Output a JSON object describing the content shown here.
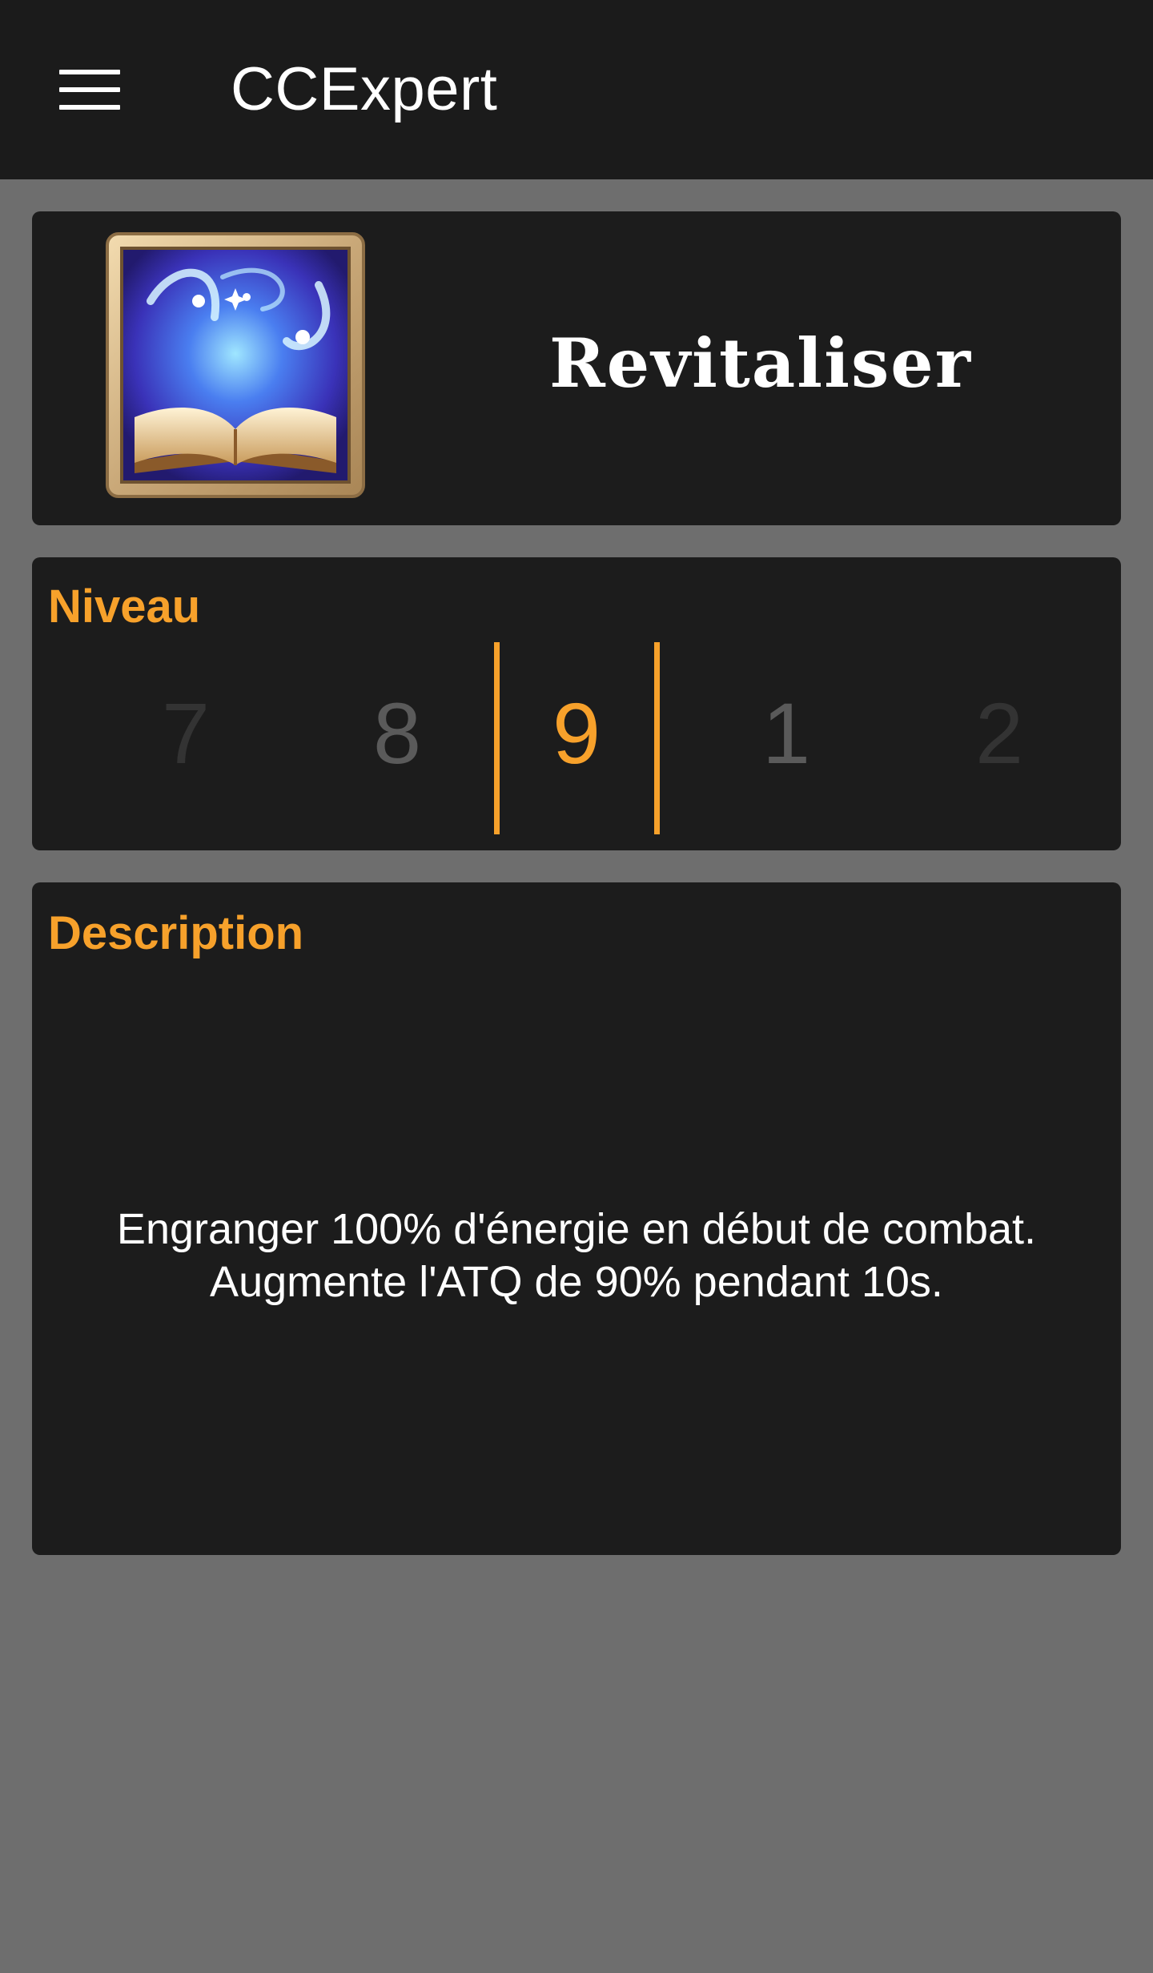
{
  "app": {
    "title": "CCExpert"
  },
  "skill": {
    "name": "Revitaliser",
    "icon": "spellbook-skill-icon"
  },
  "level": {
    "label": "Niveau",
    "options": [
      "7",
      "8",
      "9",
      "1",
      "2"
    ],
    "selected": "9"
  },
  "description": {
    "label": "Description",
    "lines": [
      "Engranger 100% d'énergie en début de combat.",
      "Augmente l'ATQ de 90% pendant 10s."
    ]
  },
  "colors": {
    "accent": "#f7a12b",
    "appbar": "#1b1b1b",
    "card": "#1c1c1c",
    "background": "#6e6e6e",
    "picker_faded": "#333333",
    "picker_near": "#5a5a5a"
  }
}
